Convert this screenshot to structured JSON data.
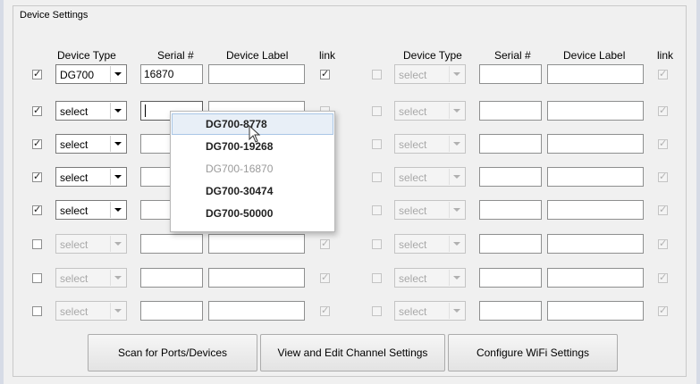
{
  "group_title": "Device Settings",
  "headers": {
    "device_type": "Device Type",
    "serial": "Serial #",
    "device_label": "Device Label",
    "link": "link"
  },
  "left_rows": [
    {
      "enabled": true,
      "checked": true,
      "device_type": "DG700",
      "serial": "16870",
      "label": "",
      "link_checked": true
    },
    {
      "enabled": true,
      "checked": true,
      "device_type": "select",
      "serial": "",
      "label": "",
      "link_checked": false
    },
    {
      "enabled": true,
      "checked": true,
      "device_type": "select",
      "serial": "",
      "label": "",
      "link_checked": false
    },
    {
      "enabled": true,
      "checked": true,
      "device_type": "select",
      "serial": "",
      "label": "",
      "link_checked": false
    },
    {
      "enabled": true,
      "checked": true,
      "device_type": "select",
      "serial": "",
      "label": "",
      "link_checked": false
    },
    {
      "enabled": false,
      "checked": false,
      "device_type": "select",
      "serial": "",
      "label": "",
      "link_checked": true
    },
    {
      "enabled": false,
      "checked": false,
      "device_type": "select",
      "serial": "",
      "label": "",
      "link_checked": true
    },
    {
      "enabled": false,
      "checked": false,
      "device_type": "select",
      "serial": "",
      "label": "",
      "link_checked": true
    }
  ],
  "right_rows": [
    {
      "enabled": false,
      "checked": false,
      "device_type": "select",
      "serial": "",
      "label": "",
      "link_checked": true
    },
    {
      "enabled": false,
      "checked": false,
      "device_type": "select",
      "serial": "",
      "label": "",
      "link_checked": true
    },
    {
      "enabled": false,
      "checked": false,
      "device_type": "select",
      "serial": "",
      "label": "",
      "link_checked": true
    },
    {
      "enabled": false,
      "checked": false,
      "device_type": "select",
      "serial": "",
      "label": "",
      "link_checked": true
    },
    {
      "enabled": false,
      "checked": false,
      "device_type": "select",
      "serial": "",
      "label": "",
      "link_checked": true
    },
    {
      "enabled": false,
      "checked": false,
      "device_type": "select",
      "serial": "",
      "label": "",
      "link_checked": true
    },
    {
      "enabled": false,
      "checked": false,
      "device_type": "select",
      "serial": "",
      "label": "",
      "link_checked": true
    },
    {
      "enabled": false,
      "checked": false,
      "device_type": "select",
      "serial": "",
      "label": "",
      "link_checked": true
    }
  ],
  "check_glyph": "✓",
  "popup_items": [
    {
      "label": "DG700-8778",
      "state": "hover"
    },
    {
      "label": "DG700-19268",
      "state": "normal"
    },
    {
      "label": "DG700-16870",
      "state": "disabled"
    },
    {
      "label": "DG700-30474",
      "state": "normal"
    },
    {
      "label": "DG700-50000",
      "state": "normal"
    }
  ],
  "buttons": {
    "scan": "Scan for Ports/Devices",
    "channel": "View and Edit Channel Settings",
    "wifi": "Configure WiFi Settings"
  }
}
